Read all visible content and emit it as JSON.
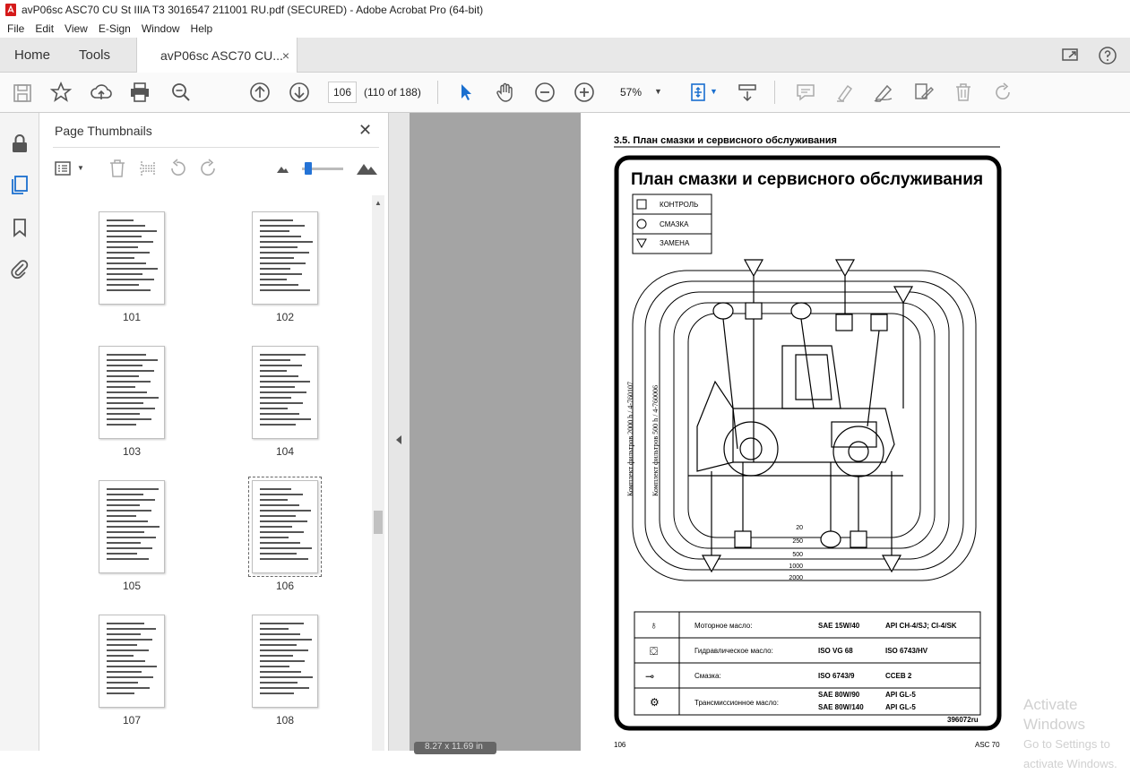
{
  "window": {
    "title": "avP06sc ASC70 CU St IIIA T3 3016547 211001 RU.pdf (SECURED) - Adobe Acrobat Pro (64-bit)"
  },
  "menu": [
    "File",
    "Edit",
    "View",
    "E-Sign",
    "Window",
    "Help"
  ],
  "tabs": {
    "home": "Home",
    "tools": "Tools",
    "doc": "avP06sc ASC70 CU...",
    "close": "×"
  },
  "toolbar": {
    "page": "106",
    "of": "(110 of 188)",
    "zoom": "57%"
  },
  "panel": {
    "title": "Page Thumbnails",
    "close": "✕",
    "thumbs": [
      {
        "label": "101"
      },
      {
        "label": "102"
      },
      {
        "label": "103"
      },
      {
        "label": "104"
      },
      {
        "label": "105"
      },
      {
        "label": "106",
        "selected": true
      },
      {
        "label": "107"
      },
      {
        "label": "108"
      }
    ]
  },
  "page": {
    "section": "3.5.    План смазки и сервисного обслуживания",
    "title": "План смазки и сервисного обслуживания",
    "legend": [
      "КОНТРОЛЬ",
      "СМАЗКА",
      "ЗАМЕНА"
    ],
    "left_text_1": "Комплект фильтров 2000 h / 4-760107",
    "left_text_2": "Комплект фильтров 500 h / 4-760006",
    "intervals": [
      "20",
      "250",
      "500",
      "1000",
      "2000"
    ],
    "table": [
      {
        "name": "Моторное масло:",
        "spec1": "SAE 15W/40",
        "spec2": "API CH-4/SJ; CI-4/SK"
      },
      {
        "name": "Гидравлическое масло:",
        "spec1": "ISO VG 68",
        "spec2": "ISO 6743/HV"
      },
      {
        "name": "Смазка:",
        "spec1": "ISO 6743/9",
        "spec2": "CCEB 2"
      },
      {
        "name": "Трансмиссионное масло:",
        "spec1": "SAE 80W/90",
        "spec2": "API GL-5",
        "spec3": "SAE 80W/140",
        "spec4": "API GL-5"
      }
    ],
    "code": "396072ru",
    "footer_left": "106",
    "footer_right": "ASC 70"
  },
  "watermark": {
    "line1": "Activate Windows",
    "line2": "Go to Settings to activate Windows."
  },
  "page_indicator": "8.27 x 11.69 in"
}
